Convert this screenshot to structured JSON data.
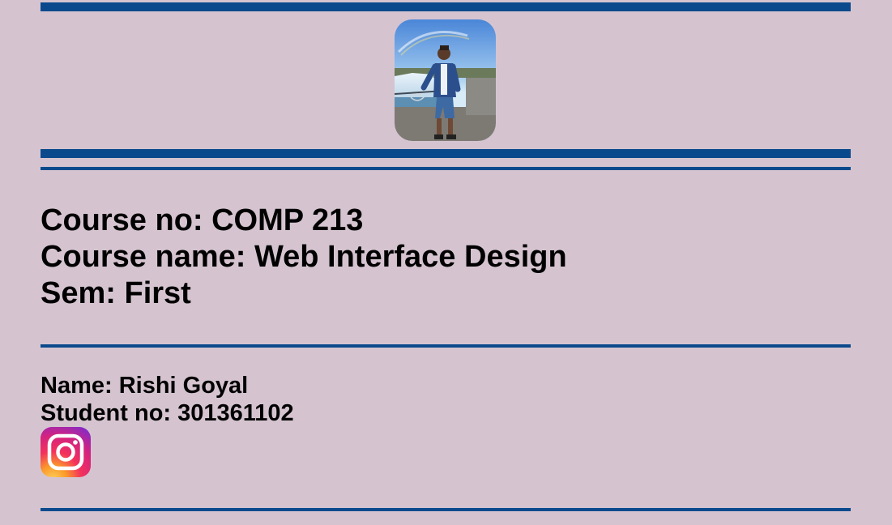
{
  "colors": {
    "background": "#d5c4d0",
    "accent_bar": "#0a4a8c"
  },
  "header": {
    "photo": {
      "icon": "profile-photo"
    }
  },
  "course": {
    "number_line": "Course no: COMP 213",
    "name_line": "Course name: Web Interface Design",
    "semester_line": "Sem: First"
  },
  "student": {
    "name_line": "Name: Rishi Goyal",
    "number_line": "Student no: 301361102"
  },
  "social": {
    "instagram": {
      "icon": "instagram-icon"
    }
  }
}
